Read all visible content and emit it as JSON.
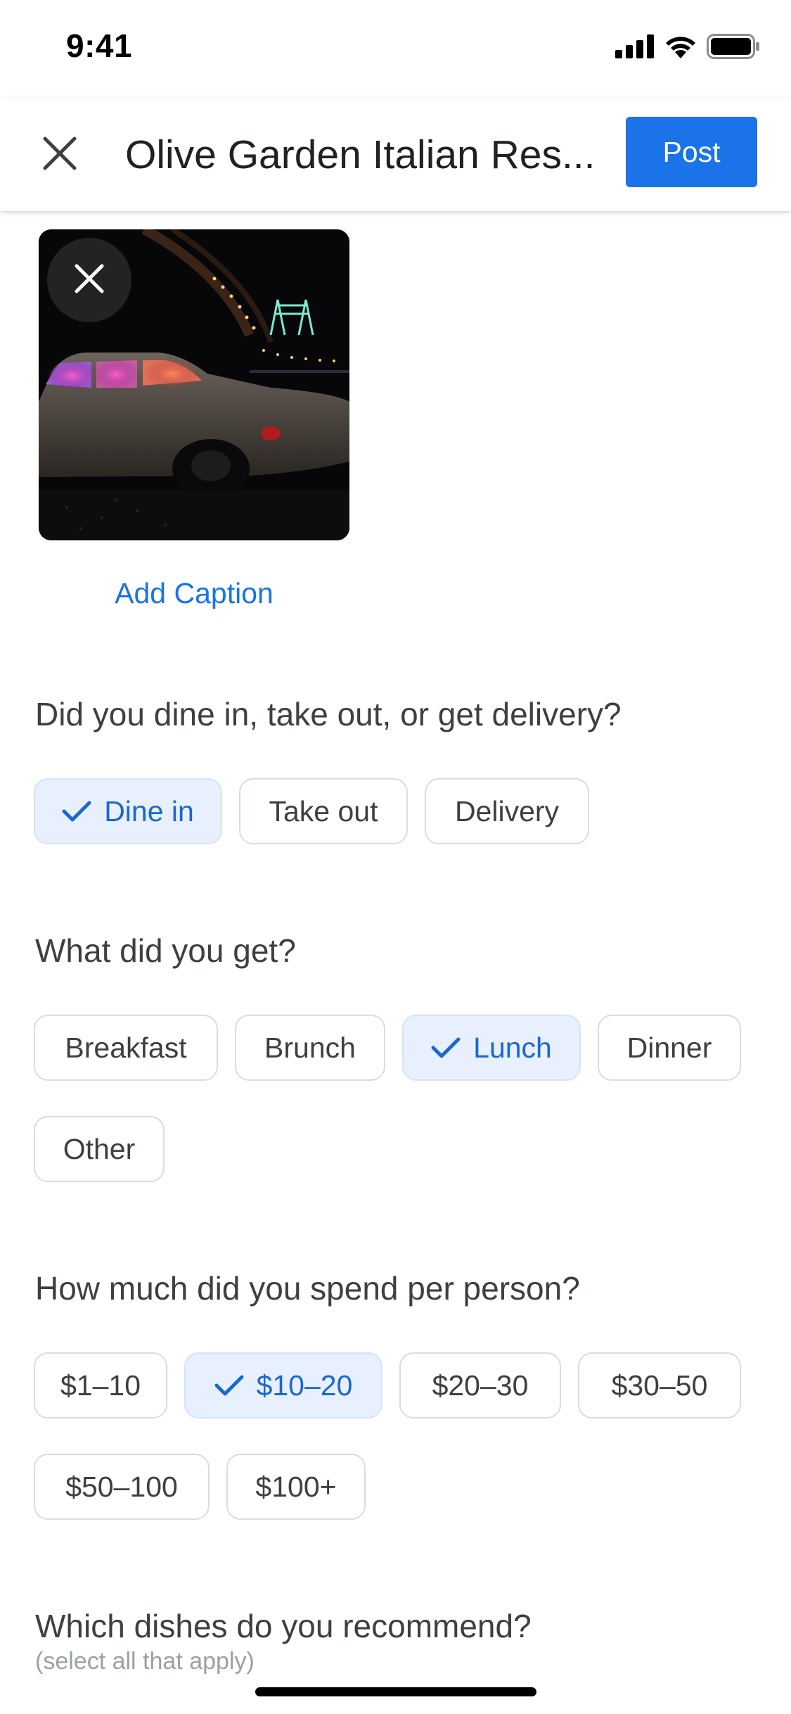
{
  "status_bar": {
    "time": "9:41",
    "icons": [
      "cellular-signal-icon",
      "wifi-icon",
      "battery-icon"
    ]
  },
  "app_bar": {
    "close_icon": "close-icon",
    "title": "Olive Garden Italian Res...",
    "post_label": "Post"
  },
  "photo": {
    "remove_icon": "close-icon",
    "add_caption_label": "Add Caption"
  },
  "questions": {
    "dining": {
      "text": "Did you dine in, take out, or get delivery?",
      "options": [
        {
          "label": "Dine in",
          "selected": true
        },
        {
          "label": "Take out",
          "selected": false
        },
        {
          "label": "Delivery",
          "selected": false
        }
      ]
    },
    "meal": {
      "text": "What did you get?",
      "options": [
        {
          "label": "Breakfast",
          "selected": false
        },
        {
          "label": "Brunch",
          "selected": false
        },
        {
          "label": "Lunch",
          "selected": true
        },
        {
          "label": "Dinner",
          "selected": false
        },
        {
          "label": "Other",
          "selected": false
        }
      ]
    },
    "spend": {
      "text": "How much did you spend per person?",
      "options": [
        {
          "label": "$1–10",
          "selected": false
        },
        {
          "label": "$10–20",
          "selected": true
        },
        {
          "label": "$20–30",
          "selected": false
        },
        {
          "label": "$30–50",
          "selected": false
        },
        {
          "label": "$50–100",
          "selected": false
        },
        {
          "label": "$100+",
          "selected": false
        }
      ]
    },
    "dishes": {
      "text": "Which dishes do you recommend?",
      "subtext": "(select all that apply)"
    }
  },
  "colors": {
    "accent": "#1a73e8",
    "selected_chip_bg": "#e8f0fe",
    "selected_chip_text": "#1967d2",
    "chip_border": "#dadce0",
    "text": "#3c4043"
  }
}
